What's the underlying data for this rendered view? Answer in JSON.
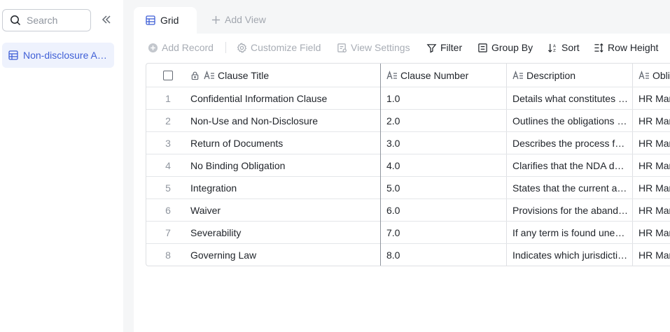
{
  "sidebar": {
    "search_placeholder": "Search",
    "items": [
      {
        "label": "Non-disclosure Agreement"
      }
    ]
  },
  "tabs": {
    "active": "Grid",
    "add_view": "Add View"
  },
  "toolbar": {
    "add_record": "Add Record",
    "customize_field": "Customize Field",
    "view_settings": "View Settings",
    "filter": "Filter",
    "group_by": "Group By",
    "sort": "Sort",
    "row_height": "Row Height"
  },
  "table": {
    "columns": {
      "title": "Clause Title",
      "number": "Clause Number",
      "description": "Description",
      "obligation": "Obligation"
    },
    "rows": [
      {
        "idx": "1",
        "title": "Confidential Information Clause",
        "number": "1.0",
        "description": "Details what constitutes confidential information",
        "obligation": "HR Manager"
      },
      {
        "idx": "2",
        "title": "Non-Use and Non-Disclosure",
        "number": "2.0",
        "description": "Outlines the obligations of the receiving party",
        "obligation": "HR Manager"
      },
      {
        "idx": "3",
        "title": "Return of Documents",
        "number": "3.0",
        "description": "Describes the process for returning documents",
        "obligation": "HR Manager"
      },
      {
        "idx": "4",
        "title": "No Binding Obligation",
        "number": "4.0",
        "description": "Clarifies that the NDA does not create a binding obligation",
        "obligation": "HR Manager"
      },
      {
        "idx": "5",
        "title": "Integration",
        "number": "5.0",
        "description": "States that the current agreement is the entire agreement",
        "obligation": "HR Manager"
      },
      {
        "idx": "6",
        "title": "Waiver",
        "number": "6.0",
        "description": "Provisions for the abandonment of rights",
        "obligation": "HR Manager"
      },
      {
        "idx": "7",
        "title": "Severability",
        "number": "7.0",
        "description": "If any term is found unenforceable",
        "obligation": "HR Manager"
      },
      {
        "idx": "8",
        "title": "Governing Law",
        "number": "8.0",
        "description": "Indicates which jurisdiction's laws govern",
        "obligation": "HR Manager"
      }
    ]
  },
  "colors": {
    "accent": "#3f5fd6",
    "accent_bg": "#eef2fd",
    "border": "#dee0e3",
    "muted_text": "#a8adb5"
  }
}
